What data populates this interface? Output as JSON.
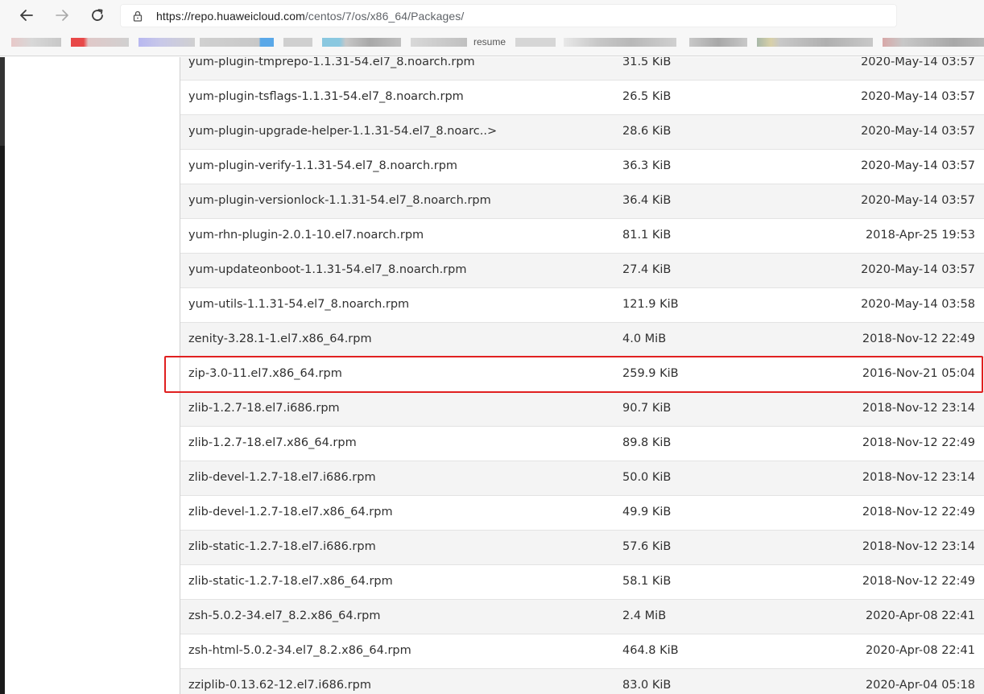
{
  "browser": {
    "url_host": "https://repo.huaweicloud.com",
    "url_path": "/centos/7/os/x86_64/Packages/",
    "bookmarks_partial_text": "resume"
  },
  "icons": {
    "back": "arrow-left-icon",
    "forward": "arrow-right-icon",
    "reload": "reload-icon",
    "lock": "lock-icon"
  },
  "highlight": {
    "color": "#e02020",
    "row_index": 9
  },
  "files": [
    {
      "name": "yum-plugin-tmprepo-1.1.31-54.el7_8.noarch.rpm",
      "size": "31.5 KiB",
      "date": "2020-May-14 03:57"
    },
    {
      "name": "yum-plugin-tsflags-1.1.31-54.el7_8.noarch.rpm",
      "size": "26.5 KiB",
      "date": "2020-May-14 03:57"
    },
    {
      "name": "yum-plugin-upgrade-helper-1.1.31-54.el7_8.noarc..>",
      "size": "28.6 KiB",
      "date": "2020-May-14 03:57"
    },
    {
      "name": "yum-plugin-verify-1.1.31-54.el7_8.noarch.rpm",
      "size": "36.3 KiB",
      "date": "2020-May-14 03:57"
    },
    {
      "name": "yum-plugin-versionlock-1.1.31-54.el7_8.noarch.rpm",
      "size": "36.4 KiB",
      "date": "2020-May-14 03:57"
    },
    {
      "name": "yum-rhn-plugin-2.0.1-10.el7.noarch.rpm",
      "size": "81.1 KiB",
      "date": "2018-Apr-25 19:53"
    },
    {
      "name": "yum-updateonboot-1.1.31-54.el7_8.noarch.rpm",
      "size": "27.4 KiB",
      "date": "2020-May-14 03:57"
    },
    {
      "name": "yum-utils-1.1.31-54.el7_8.noarch.rpm",
      "size": "121.9 KiB",
      "date": "2020-May-14 03:58"
    },
    {
      "name": "zenity-3.28.1-1.el7.x86_64.rpm",
      "size": "4.0 MiB",
      "date": "2018-Nov-12 22:49"
    },
    {
      "name": "zip-3.0-11.el7.x86_64.rpm",
      "size": "259.9 KiB",
      "date": "2016-Nov-21 05:04"
    },
    {
      "name": "zlib-1.2.7-18.el7.i686.rpm",
      "size": "90.7 KiB",
      "date": "2018-Nov-12 23:14"
    },
    {
      "name": "zlib-1.2.7-18.el7.x86_64.rpm",
      "size": "89.8 KiB",
      "date": "2018-Nov-12 22:49"
    },
    {
      "name": "zlib-devel-1.2.7-18.el7.i686.rpm",
      "size": "50.0 KiB",
      "date": "2018-Nov-12 23:14"
    },
    {
      "name": "zlib-devel-1.2.7-18.el7.x86_64.rpm",
      "size": "49.9 KiB",
      "date": "2018-Nov-12 22:49"
    },
    {
      "name": "zlib-static-1.2.7-18.el7.i686.rpm",
      "size": "57.6 KiB",
      "date": "2018-Nov-12 23:14"
    },
    {
      "name": "zlib-static-1.2.7-18.el7.x86_64.rpm",
      "size": "58.1 KiB",
      "date": "2018-Nov-12 22:49"
    },
    {
      "name": "zsh-5.0.2-34.el7_8.2.x86_64.rpm",
      "size": "2.4 MiB",
      "date": "2020-Apr-08 22:41"
    },
    {
      "name": "zsh-html-5.0.2-34.el7_8.2.x86_64.rpm",
      "size": "464.8 KiB",
      "date": "2020-Apr-08 22:41"
    },
    {
      "name": "zziplib-0.13.62-12.el7.i686.rpm",
      "size": "83.0 KiB",
      "date": "2020-Apr-04 05:18"
    }
  ]
}
